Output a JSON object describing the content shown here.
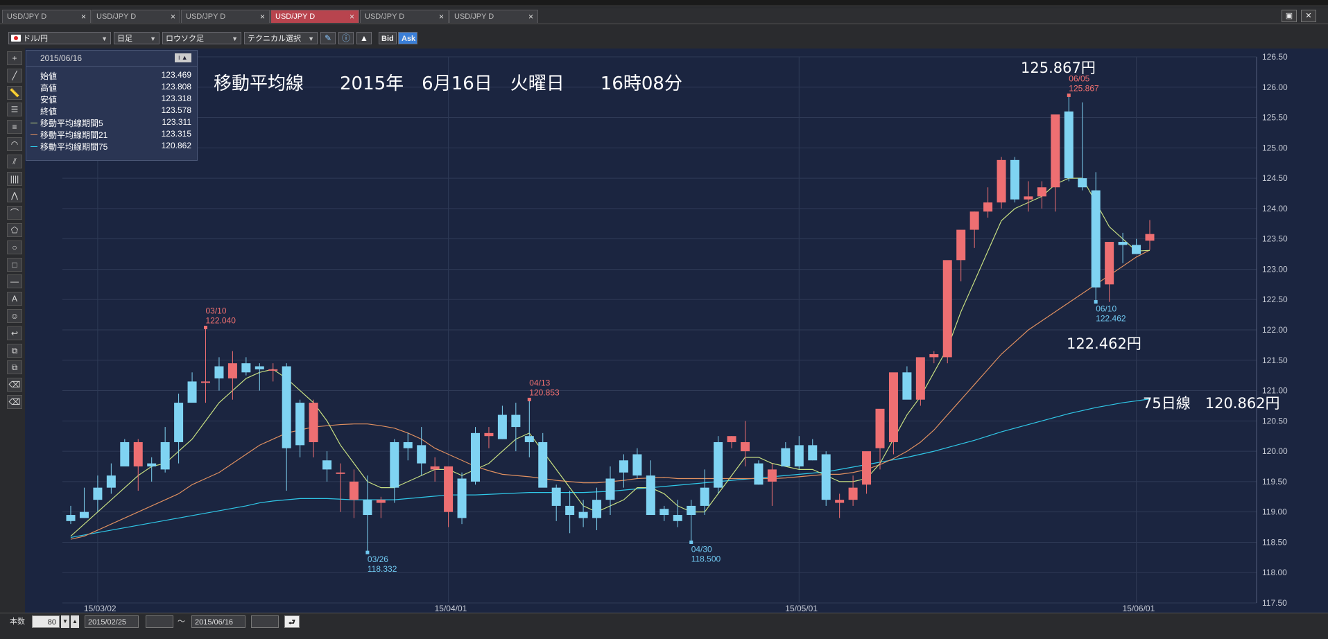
{
  "tabs": [
    {
      "label": "USD/JPY D",
      "active": false
    },
    {
      "label": "USD/JPY D",
      "active": false
    },
    {
      "label": "USD/JPY D",
      "active": false
    },
    {
      "label": "USD/JPY D",
      "active": true
    },
    {
      "label": "USD/JPY D",
      "active": false
    },
    {
      "label": "USD/JPY D",
      "active": false
    }
  ],
  "tab_close": "×",
  "window_buttons": {
    "maximize": "▣",
    "close": "✕"
  },
  "toolbar": {
    "pair": "ドル/円",
    "period": "日足",
    "chart_type": "ロウソク足",
    "technical": "テクニカル選択",
    "bid": "Bid",
    "ask": "Ask",
    "icons": [
      "pen-icon",
      "info-icon",
      "area-icon"
    ]
  },
  "left_tools": [
    "crosshair-icon",
    "line-icon",
    "ruler-icon",
    "hlines-icon",
    "fibo-icon",
    "fan-icon",
    "channel-icon",
    "vlines-icon",
    "pitchfork-icon",
    "arc-icon",
    "pentagon-icon",
    "circle-icon",
    "rectangle-icon",
    "hline-icon",
    "text-icon",
    "sticker-icon",
    "undo-icon",
    "copy-icon",
    "layers-icon",
    "eraser-icon",
    "eraser-all-icon"
  ],
  "left_tool_glyphs": [
    "+",
    "╱",
    "📏",
    "☰",
    "≡",
    "◠",
    "⫽",
    "||||",
    "⋀",
    "⌒",
    "⬠",
    "○",
    "□",
    "—",
    "A",
    "☺",
    "↩",
    "⧉",
    "⧉",
    "⌫",
    "⌫"
  ],
  "title_text": "移動平均線　　2015年　6月16日　火曜日　　16時08分",
  "info": {
    "date": "2015/06/16",
    "rows": [
      {
        "label": "始値",
        "value": "123.469",
        "color": ""
      },
      {
        "label": "高値",
        "value": "123.808",
        "color": ""
      },
      {
        "label": "安値",
        "value": "123.318",
        "color": ""
      },
      {
        "label": "終値",
        "value": "123.578",
        "color": ""
      },
      {
        "label": "移動平均線期間5",
        "value": "123.311",
        "color": "#c8e082"
      },
      {
        "label": "移動平均線期間21",
        "value": "123.315",
        "color": "#e09060"
      },
      {
        "label": "移動平均線期間75",
        "value": "120.862",
        "color": "#30c8e8"
      }
    ]
  },
  "annotations": {
    "high_price": "125.867円",
    "low_price": "122.462円",
    "ma75_text": "75日線　120.862円"
  },
  "chart_data": {
    "type": "candlestick",
    "ylim": [
      117.5,
      126.5
    ],
    "y_ticks": [
      "117.50",
      "118.00",
      "118.50",
      "119.00",
      "119.50",
      "120.00",
      "120.50",
      "121.00",
      "121.50",
      "122.00",
      "122.50",
      "123.00",
      "123.50",
      "124.00",
      "124.50",
      "125.00",
      "125.50",
      "126.00",
      "126.50"
    ],
    "x_ticks": [
      "15/03/02",
      "15/04/01",
      "15/05/01",
      "15/06/01"
    ],
    "x_tick_index": [
      2,
      28,
      54,
      79
    ],
    "up_color": "#ee6f72",
    "down_color": "#7fd3f2",
    "ma_colors": {
      "ma5": "#c8e082",
      "ma21": "#e09060",
      "ma75": "#30c8e8"
    },
    "candles": [
      [
        118.95,
        119.1,
        118.8,
        118.85
      ],
      [
        119.0,
        119.4,
        118.9,
        118.9
      ],
      [
        119.4,
        119.6,
        119.0,
        119.2
      ],
      [
        119.6,
        119.8,
        119.3,
        119.4
      ],
      [
        120.15,
        120.2,
        119.9,
        119.75
      ],
      [
        119.75,
        120.2,
        119.35,
        120.15
      ],
      [
        119.8,
        119.9,
        119.5,
        119.75
      ],
      [
        120.15,
        120.4,
        119.65,
        119.7
      ],
      [
        120.8,
        120.95,
        119.8,
        120.15
      ],
      [
        121.15,
        121.3,
        120.9,
        120.8
      ],
      [
        121.15,
        122.04,
        120.8,
        121.15
      ],
      [
        121.4,
        121.55,
        121.0,
        121.2
      ],
      [
        121.2,
        121.65,
        120.85,
        121.45
      ],
      [
        121.45,
        121.55,
        121.25,
        121.3
      ],
      [
        121.4,
        121.45,
        121.0,
        121.35
      ],
      [
        121.35,
        121.45,
        121.15,
        121.35
      ],
      [
        121.4,
        121.45,
        119.35,
        120.05
      ],
      [
        120.8,
        120.85,
        119.9,
        120.1
      ],
      [
        120.15,
        120.85,
        119.9,
        120.8
      ],
      [
        119.85,
        120.0,
        119.5,
        119.7
      ],
      [
        119.65,
        119.8,
        119.0,
        119.65
      ],
      [
        119.2,
        119.7,
        118.9,
        119.5
      ],
      [
        119.2,
        119.6,
        118.33,
        118.95
      ],
      [
        119.15,
        119.25,
        118.9,
        119.2
      ],
      [
        120.15,
        120.2,
        119.15,
        119.4
      ],
      [
        120.15,
        120.3,
        119.85,
        120.05
      ],
      [
        120.1,
        120.4,
        119.6,
        119.8
      ],
      [
        119.7,
        119.9,
        119.5,
        119.75
      ],
      [
        119.0,
        119.6,
        118.75,
        119.75
      ],
      [
        119.55,
        119.65,
        118.8,
        118.9
      ],
      [
        120.3,
        120.4,
        119.45,
        119.5
      ],
      [
        120.25,
        120.4,
        120.05,
        120.3
      ],
      [
        120.6,
        120.75,
        120.2,
        120.2
      ],
      [
        120.6,
        120.8,
        120.0,
        120.4
      ],
      [
        120.25,
        120.85,
        119.9,
        120.15
      ],
      [
        120.15,
        120.3,
        119.5,
        119.4
      ],
      [
        119.4,
        119.45,
        118.85,
        119.1
      ],
      [
        119.1,
        119.35,
        118.65,
        118.95
      ],
      [
        119.0,
        119.2,
        118.75,
        118.9
      ],
      [
        119.2,
        119.4,
        118.7,
        118.9
      ],
      [
        119.55,
        119.75,
        118.95,
        119.2
      ],
      [
        119.85,
        119.95,
        119.4,
        119.65
      ],
      [
        119.95,
        120.05,
        119.55,
        119.6
      ],
      [
        119.6,
        119.85,
        119.2,
        118.95
      ],
      [
        119.05,
        119.1,
        118.85,
        118.95
      ],
      [
        118.95,
        119.2,
        118.75,
        118.85
      ],
      [
        119.1,
        119.2,
        118.5,
        118.95
      ],
      [
        119.4,
        119.7,
        118.95,
        119.1
      ],
      [
        120.15,
        120.25,
        119.3,
        119.4
      ],
      [
        120.15,
        120.25,
        120.05,
        120.25
      ],
      [
        120.0,
        120.5,
        119.75,
        120.15
      ],
      [
        119.8,
        119.85,
        119.45,
        119.45
      ],
      [
        119.5,
        119.8,
        119.1,
        119.7
      ],
      [
        120.05,
        120.15,
        119.75,
        119.75
      ],
      [
        120.1,
        120.25,
        119.7,
        119.75
      ],
      [
        120.1,
        120.2,
        119.85,
        119.85
      ],
      [
        119.95,
        120.0,
        119.1,
        119.2
      ],
      [
        119.15,
        119.3,
        118.9,
        119.2
      ],
      [
        119.2,
        119.6,
        119.1,
        119.4
      ],
      [
        119.45,
        119.9,
        119.3,
        120.0
      ],
      [
        120.05,
        120.25,
        119.7,
        120.7
      ],
      [
        120.15,
        120.25,
        119.95,
        121.3
      ],
      [
        121.3,
        121.4,
        121.0,
        120.85
      ],
      [
        120.85,
        121.5,
        120.75,
        121.55
      ],
      [
        121.55,
        121.65,
        121.45,
        121.6
      ],
      [
        121.55,
        121.7,
        121.45,
        123.15
      ],
      [
        123.15,
        123.35,
        122.8,
        123.65
      ],
      [
        123.65,
        123.95,
        123.35,
        123.95
      ],
      [
        123.95,
        124.35,
        123.85,
        124.1
      ],
      [
        124.1,
        124.85,
        124.0,
        124.8
      ],
      [
        124.8,
        124.85,
        124.1,
        124.15
      ],
      [
        124.15,
        124.45,
        123.95,
        124.2
      ],
      [
        124.2,
        124.45,
        124.0,
        124.35
      ],
      [
        124.35,
        124.55,
        123.95,
        125.55
      ],
      [
        125.6,
        125.87,
        124.45,
        124.5
      ],
      [
        124.5,
        125.75,
        124.3,
        124.35
      ],
      [
        124.3,
        124.6,
        122.46,
        122.7
      ],
      [
        122.75,
        123.4,
        122.46,
        123.45
      ],
      [
        123.45,
        123.6,
        123.1,
        123.4
      ],
      [
        123.4,
        123.5,
        123.3,
        123.25
      ],
      [
        123.47,
        123.81,
        123.32,
        123.58
      ]
    ],
    "ma5": [
      118.6,
      118.8,
      119.0,
      119.2,
      119.4,
      119.6,
      119.75,
      119.8,
      120.0,
      120.2,
      120.5,
      120.8,
      121.0,
      121.2,
      121.3,
      121.35,
      121.2,
      121.0,
      120.8,
      120.5,
      120.1,
      119.8,
      119.5,
      119.4,
      119.4,
      119.5,
      119.6,
      119.7,
      119.7,
      119.6,
      119.7,
      119.8,
      120.0,
      120.2,
      120.3,
      120.0,
      119.7,
      119.4,
      119.1,
      119.0,
      119.1,
      119.2,
      119.4,
      119.4,
      119.3,
      119.1,
      119.0,
      119.0,
      119.3,
      119.6,
      119.9,
      119.9,
      119.8,
      119.75,
      119.7,
      119.7,
      119.6,
      119.5,
      119.5,
      119.55,
      119.8,
      120.2,
      120.6,
      120.9,
      121.3,
      121.7,
      122.3,
      122.8,
      123.3,
      123.8,
      124.0,
      124.1,
      124.2,
      124.4,
      124.5,
      124.5,
      124.1,
      123.7,
      123.5,
      123.3,
      123.31
    ],
    "ma21": [
      118.55,
      118.6,
      118.7,
      118.8,
      118.9,
      119.0,
      119.1,
      119.2,
      119.3,
      119.45,
      119.55,
      119.65,
      119.8,
      119.95,
      120.1,
      120.2,
      120.3,
      120.35,
      120.4,
      120.42,
      120.44,
      120.45,
      120.45,
      120.42,
      120.38,
      120.3,
      120.2,
      120.05,
      119.95,
      119.85,
      119.75,
      119.68,
      119.62,
      119.6,
      119.58,
      119.55,
      119.52,
      119.5,
      119.48,
      119.48,
      119.5,
      119.52,
      119.55,
      119.56,
      119.57,
      119.55,
      119.55,
      119.55,
      119.55,
      119.55,
      119.55,
      119.55,
      119.55,
      119.56,
      119.58,
      119.6,
      119.62,
      119.62,
      119.65,
      119.7,
      119.78,
      119.88,
      120.0,
      120.15,
      120.35,
      120.6,
      120.85,
      121.1,
      121.35,
      121.6,
      121.8,
      122.0,
      122.15,
      122.3,
      122.45,
      122.6,
      122.75,
      122.9,
      123.05,
      123.2,
      123.315
    ],
    "ma75": [
      118.58,
      118.62,
      118.66,
      118.7,
      118.74,
      118.78,
      118.82,
      118.86,
      118.9,
      118.94,
      118.98,
      119.02,
      119.06,
      119.1,
      119.15,
      119.18,
      119.2,
      119.22,
      119.22,
      119.22,
      119.21,
      119.2,
      119.2,
      119.2,
      119.2,
      119.22,
      119.24,
      119.26,
      119.28,
      119.28,
      119.28,
      119.29,
      119.3,
      119.31,
      119.32,
      119.32,
      119.32,
      119.32,
      119.32,
      119.33,
      119.34,
      119.36,
      119.38,
      119.4,
      119.42,
      119.44,
      119.46,
      119.48,
      119.5,
      119.52,
      119.54,
      119.56,
      119.58,
      119.6,
      119.62,
      119.64,
      119.66,
      119.7,
      119.74,
      119.78,
      119.82,
      119.86,
      119.9,
      119.95,
      120.0,
      120.06,
      120.12,
      120.18,
      120.25,
      120.32,
      120.38,
      120.44,
      120.5,
      120.56,
      120.62,
      120.67,
      120.72,
      120.76,
      120.8,
      120.83,
      120.862
    ],
    "labels": [
      {
        "idx": 10,
        "price": 122.04,
        "date": "03/10",
        "value": "122.040",
        "kind": "high"
      },
      {
        "idx": 22,
        "price": 118.332,
        "date": "03/26",
        "value": "118.332",
        "kind": "low"
      },
      {
        "idx": 34,
        "price": 120.853,
        "date": "04/13",
        "value": "120.853",
        "kind": "high"
      },
      {
        "idx": 46,
        "price": 118.5,
        "date": "04/30",
        "value": "118.500",
        "kind": "low"
      },
      {
        "idx": 74,
        "price": 125.867,
        "date": "06/05",
        "value": "125.867",
        "kind": "high"
      },
      {
        "idx": 76,
        "price": 122.462,
        "date": "06/10",
        "value": "122.462",
        "kind": "low"
      }
    ]
  },
  "bottom": {
    "count_label": "本数",
    "count_value": "80",
    "from_date": "2015/02/25",
    "tilde": "～",
    "to_date": "2015/06/16",
    "return_glyph": "⮐"
  }
}
